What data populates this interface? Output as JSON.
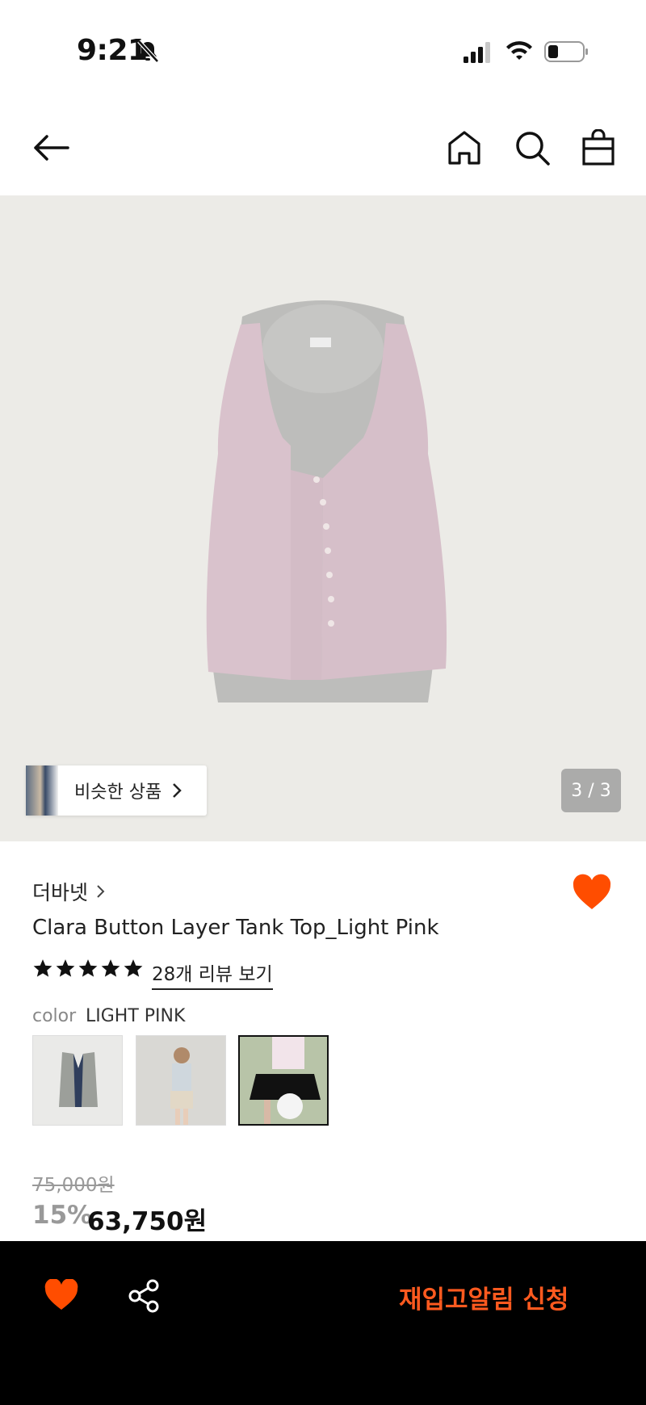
{
  "status": {
    "time": "9:21"
  },
  "header": {
    "icons": [
      "back-arrow-icon",
      "home-icon",
      "search-icon",
      "shopping-bag-icon"
    ]
  },
  "gallery": {
    "similar_label": "비슷한 상품",
    "counter": "3 / 3"
  },
  "product": {
    "brand": "더바넷",
    "title": "Clara Button Layer Tank Top_Light Pink",
    "rating_stars": 5,
    "reviews_link": "28개 리뷰 보기",
    "color_label": "color",
    "color_value": "LIGHT PINK",
    "original_price": "75,000원",
    "discount": "15%",
    "price": "63,750원",
    "wishlisted": true
  },
  "bottom": {
    "restock_label": "재입고알림 신청"
  },
  "colors": {
    "accent": "#ff4d00",
    "restock_text": "#ff5a1f",
    "bar": "#000000"
  }
}
